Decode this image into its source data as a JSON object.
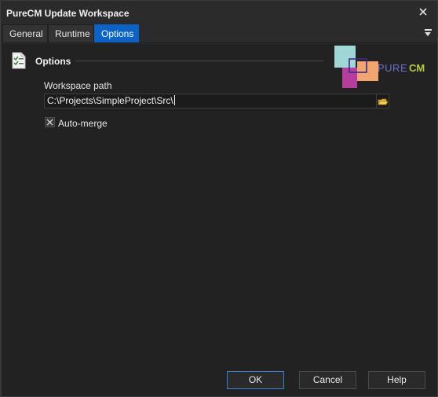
{
  "window": {
    "title": "PureCM Update Workspace"
  },
  "tabs": [
    {
      "label": "General"
    },
    {
      "label": "Runtime"
    },
    {
      "label": "Options",
      "active": true
    }
  ],
  "section": {
    "title": "Options",
    "icon": "checklist-icon"
  },
  "logo": {
    "text_pure": "PURE",
    "text_cm": "CM",
    "colors": {
      "cyan": "#9fd6d6",
      "orange": "#f2a56e",
      "magenta": "#b53d9e",
      "navy": "#3a2a8a",
      "cm_green": "#b5cc3a"
    }
  },
  "workspace_path": {
    "label": "Workspace path",
    "value": "C:\\Projects\\SimpleProject\\Src\\"
  },
  "auto_merge": {
    "label": "Auto-merge",
    "checked": true
  },
  "buttons": {
    "ok": "OK",
    "cancel": "Cancel",
    "help": "Help"
  },
  "colors": {
    "accent": "#0a64c8",
    "background": "#222222"
  }
}
